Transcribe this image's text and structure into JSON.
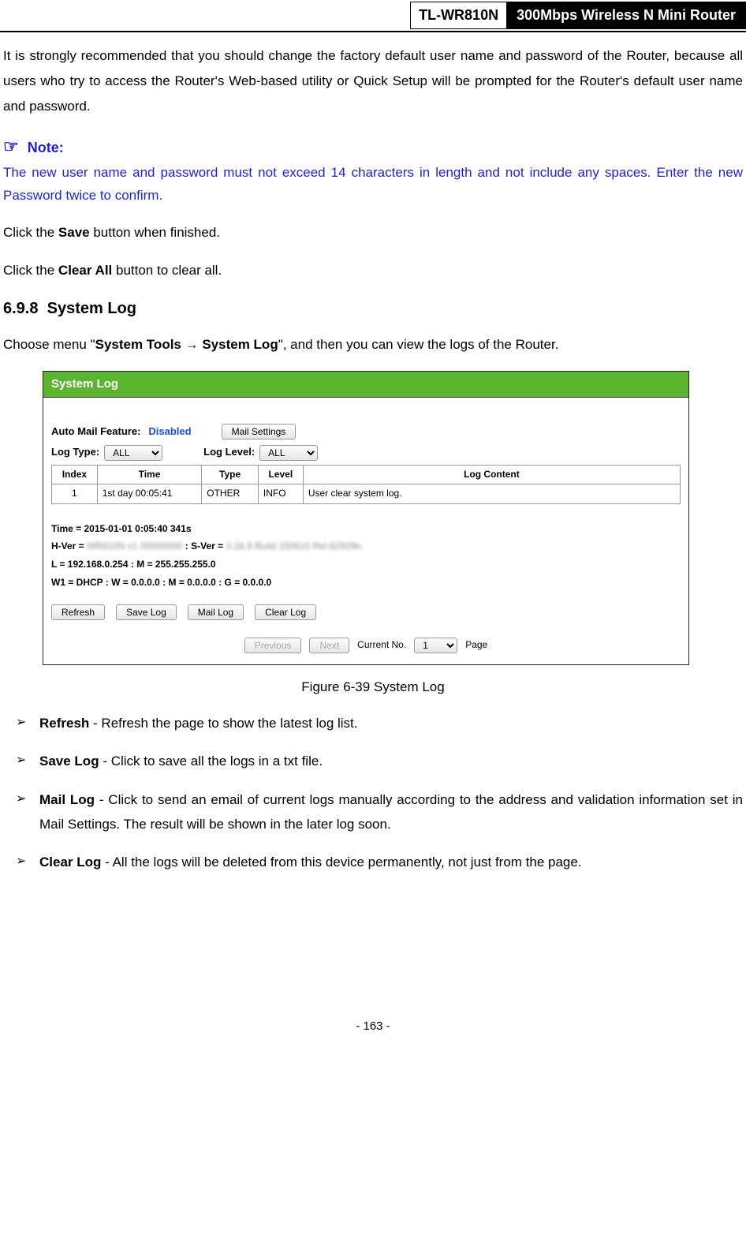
{
  "header": {
    "model": "TL-WR810N",
    "desc": "300Mbps Wireless N Mini Router"
  },
  "intro": "It is strongly recommended that you should change the factory default user name and password of the Router, because all users who try to access the Router's Web-based utility or Quick Setup will be prompted for the Router's default user name and password.",
  "note": {
    "title": "Note:",
    "body": "The new user name and password must not exceed 14 characters in length and not include any spaces. Enter the new Password twice to confirm."
  },
  "save_line_pre": "Click the ",
  "save_bold": "Save",
  "save_line_post": " button when finished.",
  "clear_line_pre": "Click the ",
  "clear_bold": "Clear All",
  "clear_line_post": " button to clear all.",
  "section": {
    "num": "6.9.8",
    "title": "System Log"
  },
  "choose_pre": "Choose menu \"",
  "choose_b1": "System Tools",
  "choose_arrow": " → ",
  "choose_b2": "System Log",
  "choose_post": "\", and then you can view the logs of the Router.",
  "fig": {
    "titlebar": "System Log",
    "auto_mail_label": "Auto Mail Feature:",
    "auto_mail_value": "Disabled",
    "mail_settings_btn": "Mail Settings",
    "log_type_label": "Log Type:",
    "log_type_value": "ALL",
    "log_level_label": "Log Level:",
    "log_level_value": "ALL",
    "table": {
      "h_index": "Index",
      "h_time": "Time",
      "h_type": "Type",
      "h_level": "Level",
      "h_content": "Log Content",
      "r1": {
        "index": "1",
        "time": "1st day 00:05:41",
        "type": "OTHER",
        "level": "INFO",
        "content": "User clear system log."
      }
    },
    "info": {
      "time": "Time = 2015-01-01 0:05:40 341s",
      "hver_pre": "H-Ver = ",
      "hver_blur1": "WR810N v1 00000000",
      "hver_mid": " : S-Ver = ",
      "hver_blur2": "3.16.9 Build 150615 Rel.62929n",
      "lan": "L = 192.168.0.254 : M = 255.255.255.0",
      "wan": "W1 = DHCP : W = 0.0.0.0 : M = 0.0.0.0 : G = 0.0.0.0"
    },
    "buttons": {
      "refresh": "Refresh",
      "save_log": "Save Log",
      "mail_log": "Mail Log",
      "clear_log": "Clear Log"
    },
    "pager": {
      "prev": "Previous",
      "next": "Next",
      "current_label": "Current No.",
      "current_value": "1",
      "page": "Page"
    }
  },
  "caption": "Figure 6-39 System Log",
  "bullets": {
    "b1_bold": "Refresh",
    "b1_rest": " - Refresh the page to show the latest log list.",
    "b2_bold": "Save Log",
    "b2_rest": " - Click to save all the logs in a txt file.",
    "b3_bold": "Mail Log",
    "b3_rest": " - Click to send an email of current logs manually according to the address and validation information set in Mail Settings. The result will be shown in the later log soon.",
    "b4_bold": "Clear Log",
    "b4_rest": " - All the logs will be deleted from this device permanently, not just from the page."
  },
  "footer": "- 163 -"
}
